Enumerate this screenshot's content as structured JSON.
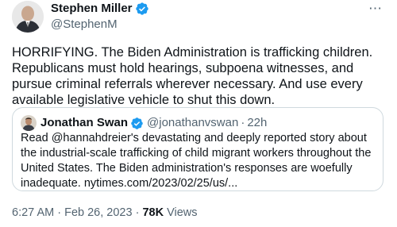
{
  "author": {
    "name": "Stephen Miller",
    "handle": "@StephenM",
    "verified": true
  },
  "tweet": {
    "text": "HORRIFYING. The Biden Administration is trafficking children. Republicans must hold hearings, subpoena witnesses, and pursue criminal referrals wherever necessary. And use every available legislative vehicle to shut this down.",
    "timestamp": "6:27 AM · Feb 26, 2023",
    "meta_separator": "·",
    "views_count": "78K",
    "views_label": "Views"
  },
  "quoted_tweet": {
    "author_name": "Jonathan Swan",
    "handle": "@jonathanvswan",
    "separator": "·",
    "time": "22h",
    "verified": true,
    "text": "Read @hannahdreier's devastating and deeply reported story about the industrial-scale trafficking of child migrant workers throughout the United States. The Biden administration's responses are woefully inadequate. nytimes.com/2023/02/25/us/..."
  },
  "icons": {
    "more": "more-icon",
    "verified": "verified-badge-icon"
  },
  "colors": {
    "verified": "#1d9bf0",
    "secondary_text": "#536471",
    "primary_text": "#0f1419",
    "border": "#cfd9de"
  }
}
